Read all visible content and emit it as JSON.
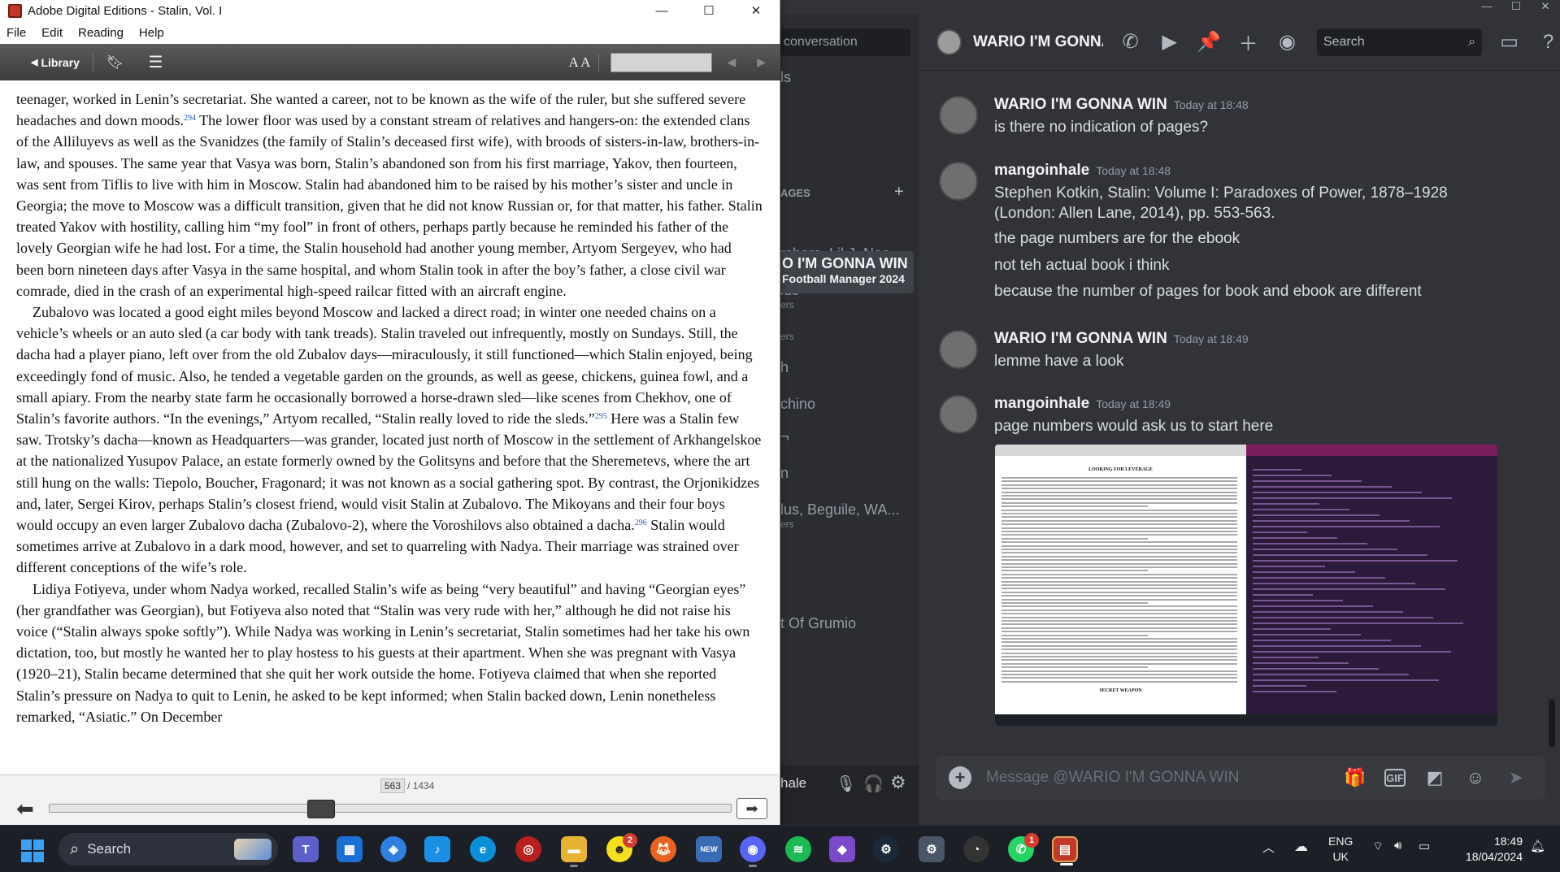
{
  "ade": {
    "window_title": "Adobe Digital Editions - Stalin, Vol. I",
    "menu": [
      "File",
      "Edit",
      "Reading",
      "Help"
    ],
    "library_label": "Library",
    "font_size_label": "A A",
    "current_page": "563",
    "total_pages": "/ 1434",
    "reading_progress": 0.393,
    "paragraphs": [
      {
        "indent": false,
        "segments": [
          {
            "t": "teenager, worked in Lenin’s secretariat. She wanted a career, not to be known as the wife of the ruler, but she suffered severe headaches and down moods."
          },
          {
            "sup": "294"
          },
          {
            "t": " The lower floor was used by a constant stream of relatives and hangers-on: the extended clans of the Alliluyevs as well as the Svanidzes (the family of Stalin’s deceased first wife), with broods of sisters-in-law, brothers-in-law, and spouses. The same year that Vasya was born, Stalin’s abandoned son from his first marriage, Yakov, then fourteen, was sent from Tiflis to live with him in Moscow. Stalin had abandoned him to be raised by his mother’s sister and uncle in Georgia; the move to Moscow was a difficult transition, given that he did not know Russian or, for that matter, his father. Stalin treated Yakov with hostility, calling him “my fool” in front of others, perhaps partly because he reminded his father of the lovely Georgian wife he had lost. For a time, the Stalin household had another young member, Artyom Sergeyev, who had been born nineteen days after Vasya in the same hospital, and whom Stalin took in after the boy’s father, a close civil war comrade, died in the crash of an experimental high-speed railcar fitted with an aircraft engine."
          }
        ]
      },
      {
        "indent": true,
        "segments": [
          {
            "t": "Zubalovo was located a good eight miles beyond Moscow and lacked a direct road; in winter one needed chains on a vehicle’s wheels or an auto sled (a car body with tank treads). Stalin traveled out infrequently, mostly on Sundays. Still, the dacha had a player piano, left over from the old Zubalov days—miraculously, it still functioned—which Stalin enjoyed, being exceedingly fond of music. Also, he tended a vegetable garden on the grounds, as well as geese, chickens, guinea fowl, and a small apiary. From the nearby state farm he occasionally borrowed a horse-drawn sled—like scenes from Chekhov, one of Stalin’s favorite authors. “In the evenings,” Artyom recalled, “Stalin really loved to ride the sleds.”"
          },
          {
            "sup": "295"
          },
          {
            "t": " Here was a Stalin few saw. Trotsky’s dacha—known as Headquarters—was grander, located just north of Moscow in the settlement of Arkhangelskoe at the nationalized Yusupov Palace, an estate formerly owned by the Golitsyns and before that the Sheremetevs, where the art still hung on the walls: Tiepolo, Boucher, Fragonard; it was not known as a social gathering spot. By contrast, the Orjonikidzes and, later, Sergei Kirov, perhaps Stalin’s closest friend, would visit Stalin at Zubalovo. The Mikoyans and their four boys would occupy an even larger Zubalovo dacha (Zubalovo-2), where the Voroshilovs also obtained a dacha."
          },
          {
            "sup": "296"
          },
          {
            "t": " Stalin would sometimes arrive at Zubalovo in a dark mood, however, and set to quarreling with Nadya. Their marriage was strained over different conceptions of the wife’s role."
          }
        ]
      },
      {
        "indent": true,
        "segments": [
          {
            "t": "Lidiya Fotiyeva, under whom Nadya worked, recalled Stalin’s wife as being “very beautiful” and having “Georgian eyes” (her grandfather was Georgian), but Fotiyeva also noted that “Stalin was very rude with her,” although he did not raise his voice (“Stalin always spoke softly”). While Nadya was working in Lenin’s secretariat, Stalin sometimes had her take his own dictation, too, but mostly he wanted her to play hostess to his guests at their apartment. When she was pregnant with Vasya (1920–21), Stalin became determined that she quit her work outside the home. Fotiyeva claimed that when she reported Stalin’s pressure on Nadya to quit to Lenin, he asked to be kept informed; when Stalin backed down, Lenin nonetheless remarked, “Asiatic.” On December"
          }
        ]
      }
    ]
  },
  "discord": {
    "search_conversation": "conversation",
    "channels": [
      {
        "name": "ls",
        "sub": ""
      },
      {
        "name": "AGES",
        "sub": ""
      },
      {
        "name": "rsbars, Lil J, Neo",
        "sub": "ers"
      },
      {
        "name": "lus",
        "sub": "ers"
      },
      {
        "name": "",
        "sub": "ers"
      },
      {
        "name": "h",
        "sub": ""
      },
      {
        "name": "chino",
        "sub": ""
      },
      {
        "name": "¬",
        "sub": ""
      },
      {
        "name": "n",
        "sub": ""
      },
      {
        "name": "lus, Beguile, WA...",
        "sub": "ers"
      },
      {
        "name": "t Of Grumio",
        "sub": ""
      }
    ],
    "active_dm": {
      "name": "O I'M GONNA WIN",
      "status": "Football Manager 2024"
    },
    "add_dm": "+",
    "user_name": "hale",
    "header_name": "WARIO I'M GONNA WIN",
    "header_search": "Search",
    "messages": [
      {
        "user": "WARIO I'M GONNA WIN",
        "time": "Today at 18:48",
        "lines": [
          "is there no indication of pages?"
        ]
      },
      {
        "user": "mangoinhale",
        "time": "Today at 18:48",
        "lines": [
          "Stephen Kotkin, Stalin: Volume I: Paradoxes of Power, 1878–1928",
          "(London: Allen Lane, 2014), pp. 553-563.",
          "the page numbers are for the ebook",
          "not teh actual book i think",
          "because the number of pages for book and ebook are different"
        ]
      },
      {
        "user": "WARIO I'M GONNA WIN",
        "time": "Today at 18:49",
        "lines": [
          "lemme have a look"
        ]
      },
      {
        "user": "mangoinhale",
        "time": "Today at 18:49",
        "lines": [
          "page numbers would ask us to start here"
        ]
      }
    ],
    "attachment_heading": "LOOKING FOR LEVERAGE",
    "attachment_footer": "SECRET WEAPON",
    "input_placeholder": "Message @WARIO I'M GONNA WIN",
    "gif_label": "GIF"
  },
  "taskbar": {
    "search_label": "Search",
    "language": "ENG",
    "region": "UK",
    "time": "18:49",
    "date": "18/04/2024",
    "badge_whatsapp": "1",
    "badge_snapchat": "2",
    "teams_new": "NEW"
  }
}
